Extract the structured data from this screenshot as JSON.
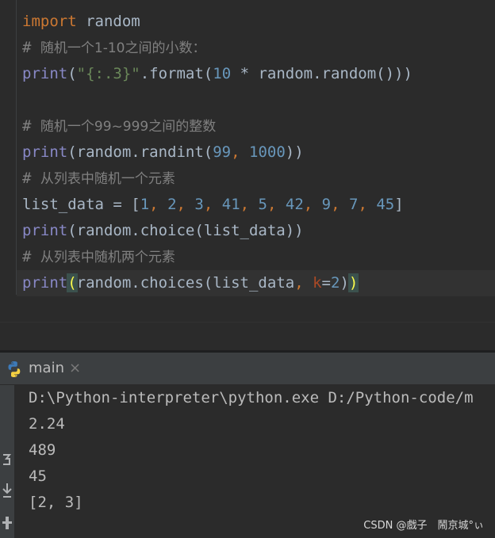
{
  "editor": {
    "lines": {
      "l1": {
        "kw": "import",
        "rest": " random"
      },
      "l2": {
        "hash": "# ",
        "text": "随机一个1-10之间的小数："
      },
      "l3": {
        "fn": "print",
        "p1": "(",
        "str": "\"{:.3}\"",
        "p2": ".format(",
        "num": "10",
        "p3": " * random.random()))"
      },
      "l5": {
        "hash": "# ",
        "text": "随机一个99~999之间的整数"
      },
      "l6": {
        "fn": "print",
        "p1": "(random.randint(",
        "n1": "99",
        "comma": ", ",
        "n2": "1000",
        "p2": "))"
      },
      "l7": {
        "hash": "# ",
        "text": "从列表中随机一个元素"
      },
      "l8": {
        "p1": "list_data = [",
        "nums": [
          "1",
          "2",
          "3",
          "41",
          "5",
          "42",
          "9",
          "7",
          "45"
        ],
        "sep": ", ",
        "p2": "]"
      },
      "l9": {
        "fn": "print",
        "p1": "(random.choice(list_data))"
      },
      "l10": {
        "hash": "# ",
        "text": "从列表中随机两个元素"
      },
      "l11": {
        "fn": "print",
        "open": "(",
        "p1": "random.choices(list_data",
        "comma": ", ",
        "param": "k",
        "eq": "=",
        "num": "2",
        "p2": ")",
        "close": ")"
      }
    }
  },
  "run_panel": {
    "tab": {
      "label": "main",
      "close": "×",
      "icon": "python-icon"
    },
    "output": [
      "D:\\Python-interpreter\\python.exe D:/Python-code/m",
      "2.24",
      "489",
      "45",
      "[2, 3]"
    ],
    "toolbar_icons": [
      "rerun-icon",
      "scroll-to-end-icon",
      "pin-icon"
    ]
  },
  "watermark": "CSDN @戲子　鬧京城°ぃ",
  "colors": {
    "background": "#2b2b2b",
    "keyword": "#cc7832",
    "builtin": "#8888c6",
    "string": "#6a8759",
    "number": "#6897bb",
    "comment": "#808080",
    "text": "#a9b7c6"
  }
}
